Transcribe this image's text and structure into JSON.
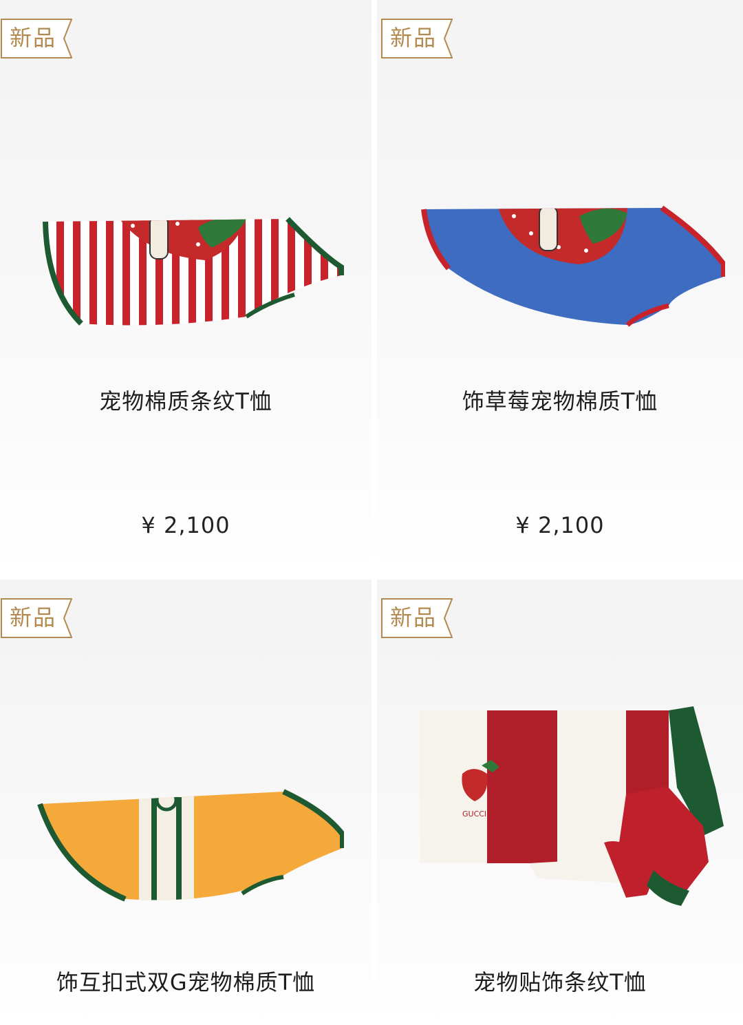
{
  "products": [
    {
      "badge": "新品",
      "name": "宠物棉质条纹T恤",
      "price": "¥ 2,100",
      "image_icon": "striped-pet-tshirt-icon"
    },
    {
      "badge": "新品",
      "name": "饰草莓宠物棉质T恤",
      "price": "¥ 2,100",
      "image_icon": "blue-strawberry-pet-tshirt-icon"
    },
    {
      "badge": "新品",
      "name": "饰互扣式双G宠物棉质T恤",
      "image_icon": "orange-gg-pet-tshirt-icon"
    },
    {
      "badge": "新品",
      "name": "宠物贴饰条纹T恤",
      "image_icon": "wide-stripe-pet-tshirt-icon"
    }
  ],
  "colors": {
    "badge_gold": "#b28a50",
    "red": "#c8232b",
    "green": "#1d5a32",
    "blue": "#3d6cc0",
    "orange": "#f5a93a"
  }
}
